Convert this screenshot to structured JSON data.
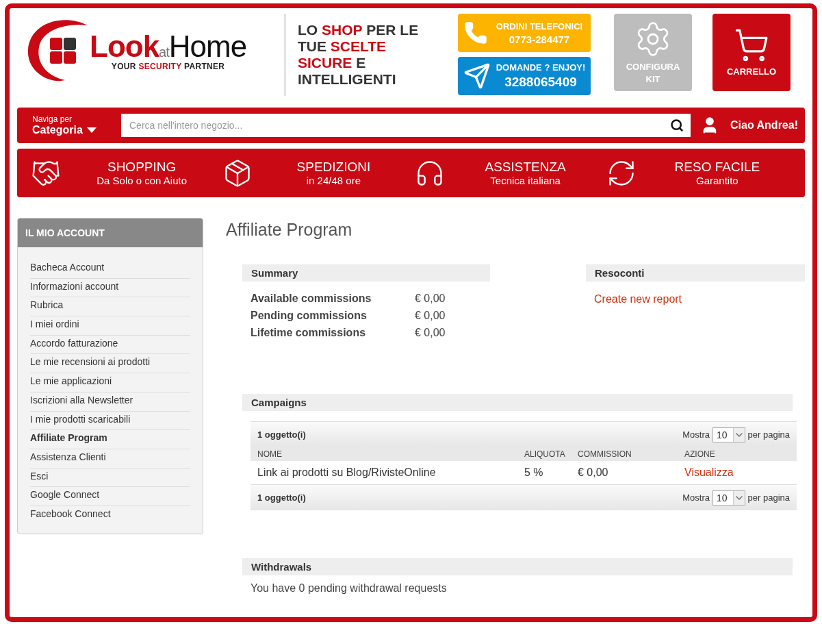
{
  "header": {
    "logo": {
      "wordmark": "**Look**$_{at}$Home",
      "slogan": "YOUR **SECURITY** PARTNER"
    },
    "tagline": "LO **SHOP** PER LE TUE **SCELTE SICURE** E INTELLIGENTI",
    "contacts": [
      {
        "kind": "phone",
        "title": "ORDINI TELEFONICI",
        "number": "0773-284477"
      },
      {
        "kind": "telegram",
        "title": "DOMANDE ? ENJOY!",
        "number": "3288065409"
      }
    ],
    "actions": [
      {
        "kind": "configure",
        "label": "CONFIGURA KIT"
      },
      {
        "kind": "cart",
        "label": "CARRELLO"
      }
    ]
  },
  "nav": {
    "browse_small": "Naviga per",
    "browse": "Categoria",
    "search": {
      "placeholder": "Cerca nell'intero negozio..."
    },
    "greeting": "Ciao Andrea!"
  },
  "features": [
    {
      "kind": "handshake",
      "title": "SHOPPING",
      "subtitle": "Da Solo o con Aiuto"
    },
    {
      "kind": "box",
      "title": "SPEDIZIONI",
      "subtitle": "in 24/48 ore"
    },
    {
      "kind": "headset",
      "title": "ASSISTENZA",
      "subtitle": "Tecnica italiana"
    },
    {
      "kind": "return",
      "title": "RESO FACILE",
      "subtitle": "Garantito"
    }
  ],
  "sidebar": {
    "title": "IL MIO ACCOUNT",
    "items": [
      {
        "label": "Bacheca Account",
        "selected": false
      },
      {
        "label": "Informazioni account",
        "selected": false
      },
      {
        "label": "Rubrica",
        "selected": false
      },
      {
        "label": "I miei ordini",
        "selected": false
      },
      {
        "label": "Accordo fatturazione",
        "selected": false
      },
      {
        "label": "Le mie recensioni ai prodotti",
        "selected": false
      },
      {
        "label": "Le mie applicazioni",
        "selected": false
      },
      {
        "label": "Iscrizioni alla Newsletter",
        "selected": false
      },
      {
        "label": "I mie prodotti scaricabili",
        "selected": false
      },
      {
        "label": "Affiliate Program",
        "selected": true
      },
      {
        "label": "Assistenza Clienti",
        "selected": false
      },
      {
        "label": "Esci",
        "selected": false
      },
      {
        "label": "Google Connect",
        "selected": false
      },
      {
        "label": "Facebook Connect",
        "selected": false
      }
    ]
  },
  "page_title": "Affiliate Program",
  "summary": {
    "title": "Summary",
    "rows": [
      {
        "label": "Available commissions",
        "value": "€ 0,00"
      },
      {
        "label": "Pending commissions",
        "value": "€ 0,00"
      },
      {
        "label": "Lifetime commissions",
        "value": "€ 0,00"
      }
    ]
  },
  "reports": {
    "title": "Resoconti",
    "link": "Create new report"
  },
  "campaigns": {
    "title": "Campaigns",
    "pagers": [
      {
        "count": "1 oggetto(i)",
        "show": "Mostra",
        "per_page": "10",
        "per_page_suffix": "per pagina"
      },
      {
        "count": "1 oggetto(i)",
        "show": "Mostra",
        "per_page": "10",
        "per_page_suffix": "per pagina"
      }
    ],
    "columns": [
      "NOME",
      "ALIQUOTA",
      "COMMISSION",
      "AZIONE"
    ],
    "rows": [
      {
        "name": "Link ai prodotti su Blog/RivisteOnline",
        "rate": "5 %",
        "commission": "€ 0,00",
        "action": "Visualizza"
      }
    ]
  },
  "withdrawals": {
    "title": "Withdrawals",
    "text": "You have 0 pending withdrawal requests"
  }
}
